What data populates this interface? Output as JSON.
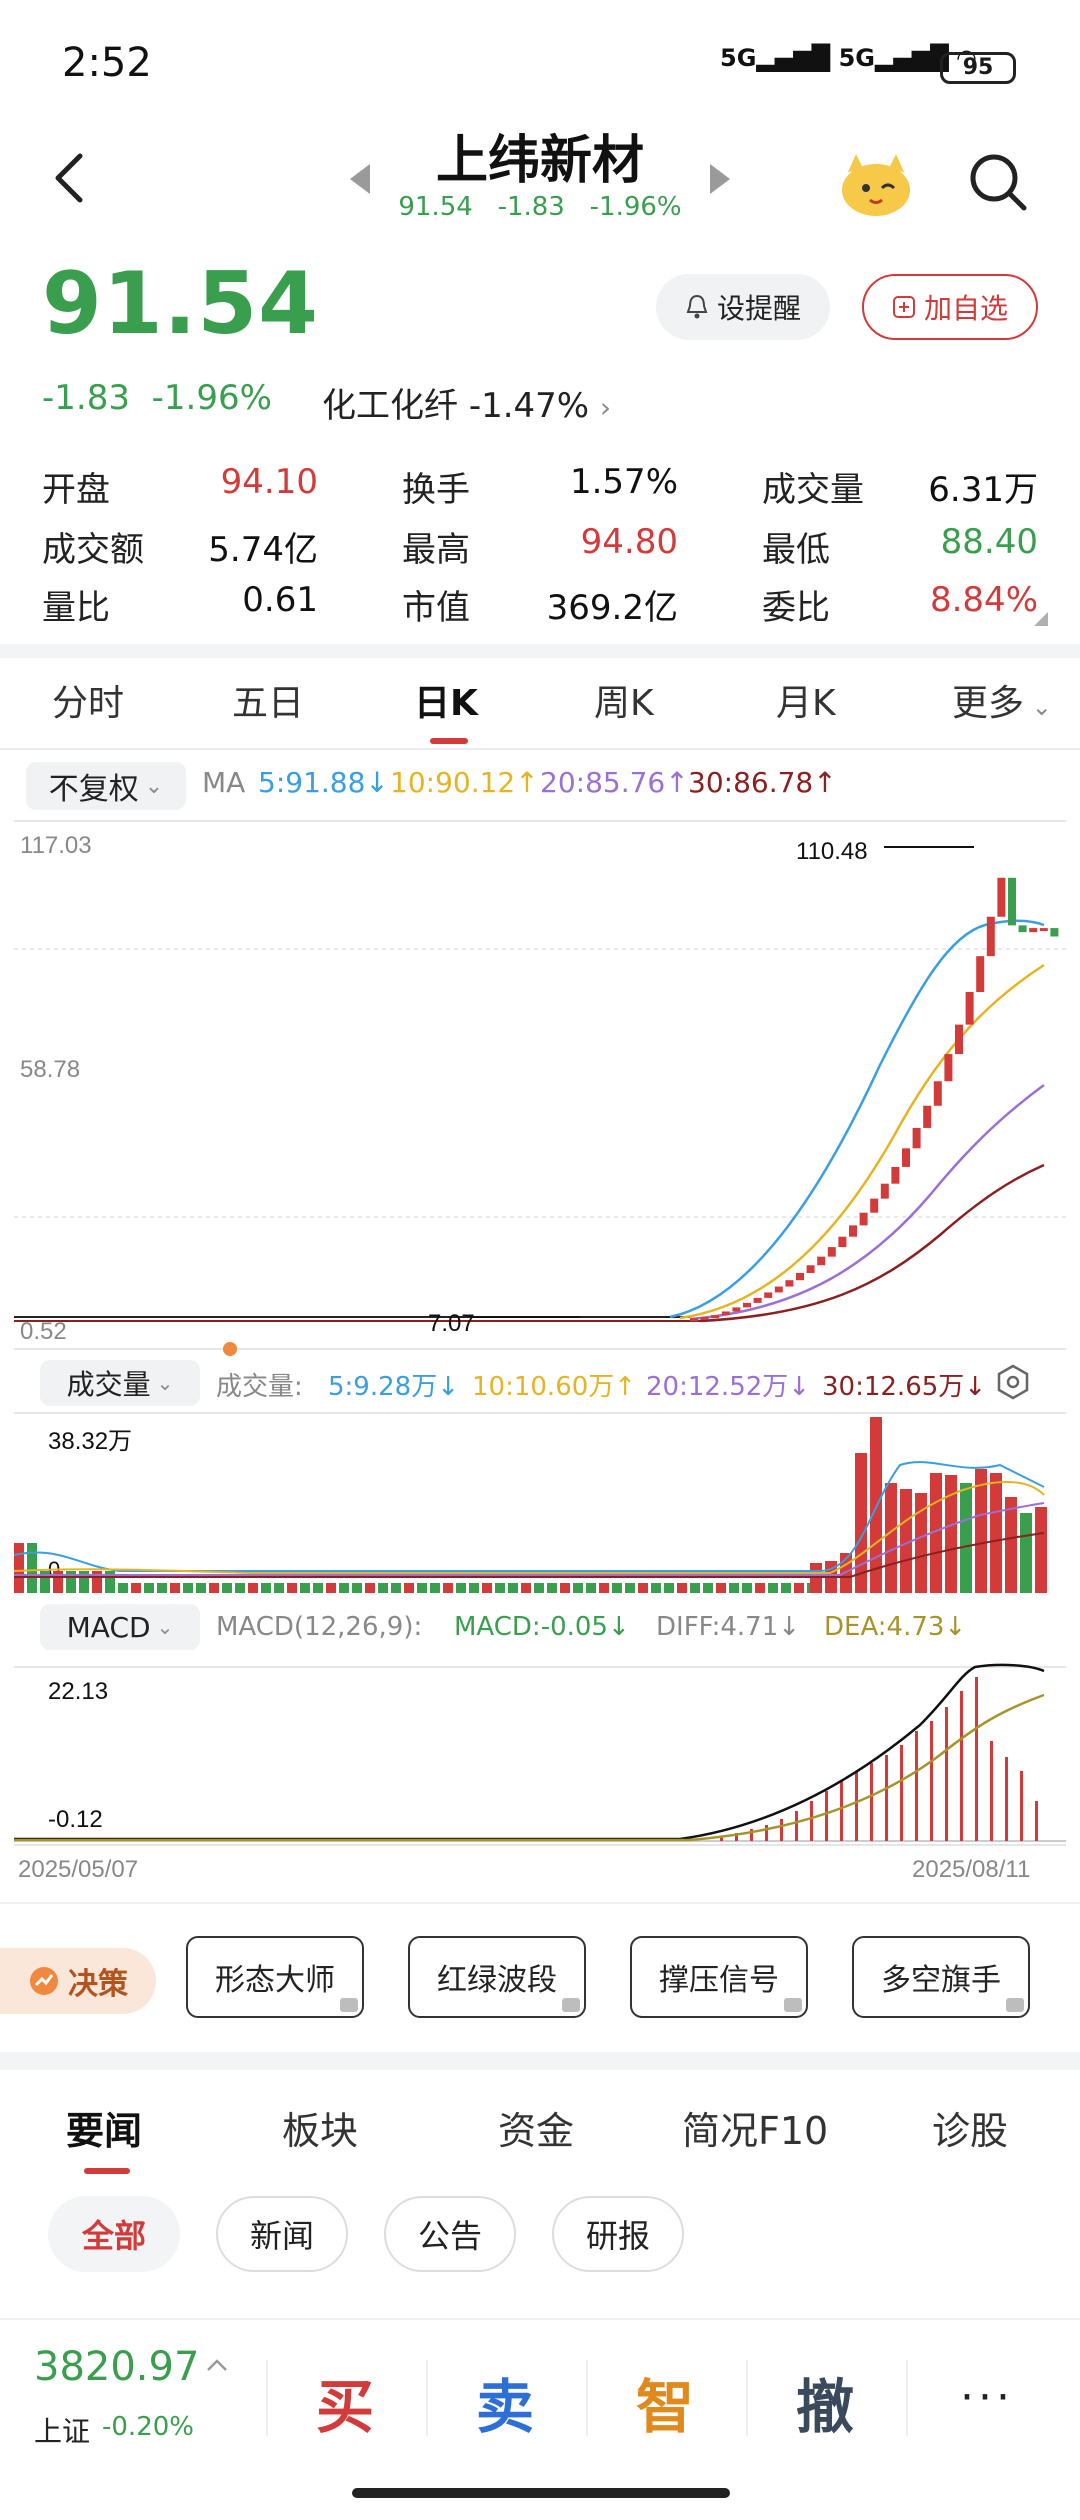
{
  "status": {
    "time": "2:52",
    "network1": "5G",
    "network2": "5G",
    "battery": "95"
  },
  "header": {
    "title": "上纬新材",
    "sub_price": "91.54",
    "sub_change": "-1.83",
    "sub_pct": "-1.96%"
  },
  "quote": {
    "price": "91.54",
    "change": "-1.83",
    "change_pct": "-1.96%",
    "sector_name": "化工化纤",
    "sector_pct": "-1.47%",
    "alert_label": "设提醒",
    "watch_label": "加自选"
  },
  "stats": [
    {
      "label": "开盘",
      "value": "94.10",
      "color": "#d33a3a"
    },
    {
      "label": "换手",
      "value": "1.57%",
      "color": "#111111"
    },
    {
      "label": "成交量",
      "value": "6.31万",
      "color": "#111111"
    },
    {
      "label": "成交额",
      "value": "5.74亿",
      "color": "#111111"
    },
    {
      "label": "最高",
      "value": "94.80",
      "color": "#d33a3a"
    },
    {
      "label": "最低",
      "value": "88.40",
      "color": "#3a9e4f"
    },
    {
      "label": "量比",
      "value": "0.61",
      "color": "#111111"
    },
    {
      "label": "市值",
      "value": "369.2亿",
      "color": "#111111"
    },
    {
      "label": "委比",
      "value": "8.84%",
      "color": "#d33a3a"
    }
  ],
  "chart_tabs": [
    "分时",
    "五日",
    "日K",
    "周K",
    "月K",
    "更多"
  ],
  "active_chart_tab": "日K",
  "adjust_label": "不复权",
  "ma_legend": {
    "prefix": "MA",
    "ma5": "5:91.88↓",
    "ma10": "10:90.12↑",
    "ma20": "20:85.76↑",
    "ma30": "30:86.78↑"
  },
  "volume_legend": {
    "dropdown": "成交量",
    "prefix": "成交量:",
    "v5": "5:9.28万↓",
    "v10": "10:10.60万↑",
    "v20": "20:12.52万↓",
    "v30": "30:12.65万↓"
  },
  "macd_legend": {
    "dropdown": "MACD",
    "params": "MACD(12,26,9):",
    "macd": "MACD:-0.05↓",
    "diff": "DIFF:4.71↓",
    "dea": "DEA:4.73↓"
  },
  "chart_labels": {
    "price_top": "117.03",
    "price_mid": "58.78",
    "price_bottom": "0.52",
    "high_marker": "110.48",
    "low_marker": "7.07",
    "vol_top": "38.32万",
    "vol_zero": "0",
    "macd_top": "22.13",
    "macd_bottom": "-0.12",
    "date_start": "2025/05/07",
    "date_end": "2025/08/11"
  },
  "colors": {
    "up": "#d33a3a",
    "down": "#3a9e4f",
    "ma5": "#3a9ee0",
    "ma10": "#e6b422",
    "ma20": "#9b6fd6",
    "ma30": "#8b2020"
  },
  "chart_data": {
    "type": "candlestick",
    "title": "",
    "x": [
      "2025/05/07",
      "2025/08/11"
    ],
    "ylim": [
      0.52,
      117.03
    ],
    "period_low": 7.07,
    "period_high": 110.48,
    "recent_closes": [
      7.1,
      7.3,
      7.6,
      8.0,
      8.8,
      9.7,
      10.7,
      11.8,
      13.0,
      14.3,
      15.7,
      17.3,
      19.0,
      20.9,
      23.0,
      25.3,
      27.8,
      30.6,
      33.7,
      37.0,
      40.7,
      44.8,
      49.3,
      54.2,
      59.6,
      65.6,
      72.1,
      79.3,
      87.2,
      95.9,
      104.5,
      94.0,
      92.5,
      93.4,
      93.4,
      91.54
    ],
    "volume_ylim": [
      0,
      38.32
    ],
    "macd_ylim": [
      -0.12,
      22.13
    ]
  },
  "strategy_tag": "决策",
  "strategy_buttons": [
    "形态大师",
    "红绿波段",
    "撑压信号",
    "多空旗手"
  ],
  "news_tabs": [
    "要闻",
    "板块",
    "资金",
    "简况F10",
    "诊股"
  ],
  "news_chips": [
    "全部",
    "新闻",
    "公告",
    "研报"
  ],
  "bottom": {
    "index_value": "3820.97",
    "index_name": "上证",
    "index_change": "-0.20%",
    "buy": "买",
    "sell": "卖",
    "smart": "智",
    "cancel": "撤",
    "more": "···"
  }
}
